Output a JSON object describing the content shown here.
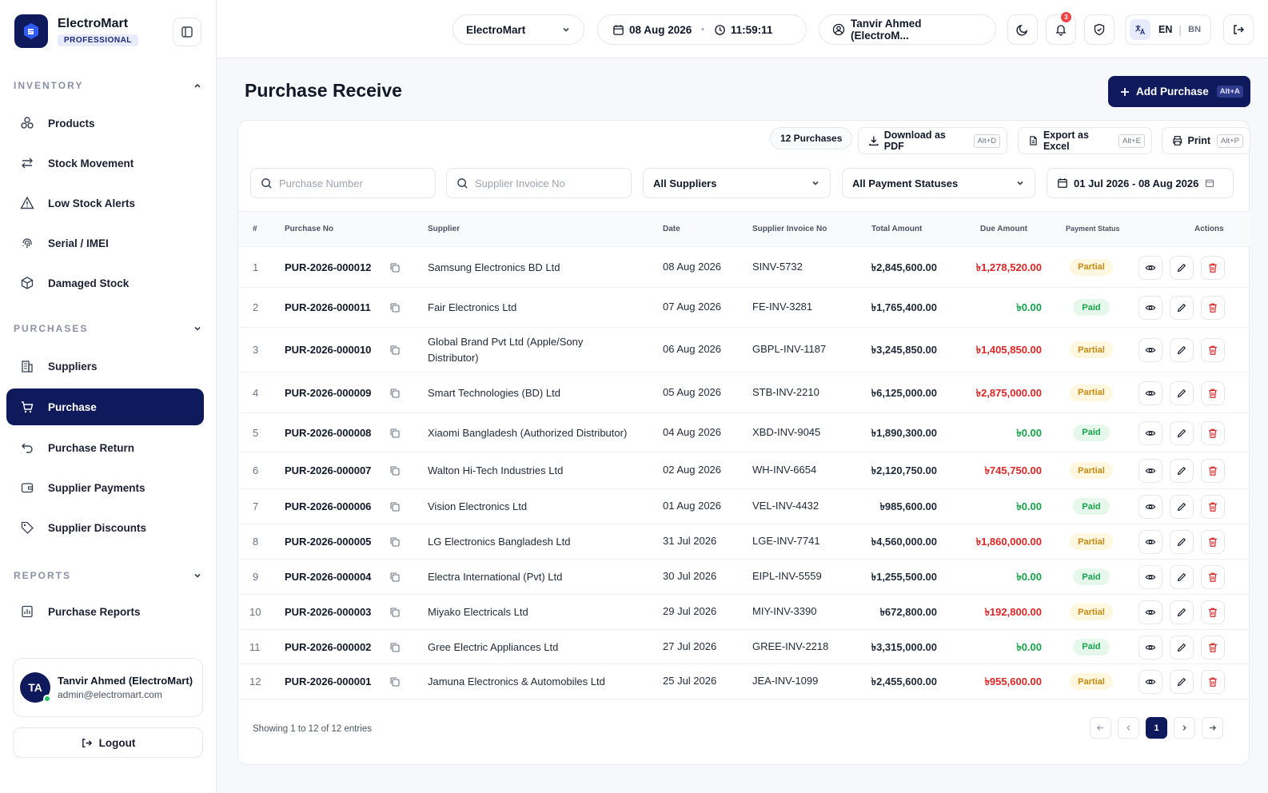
{
  "brand": {
    "name": "ElectroMart",
    "tier": "PROFESSIONAL"
  },
  "sidebar": {
    "sections": [
      {
        "title": "INVENTORY",
        "items": [
          {
            "label": "Products",
            "icon": "boxes-icon"
          },
          {
            "label": "Stock Movement",
            "icon": "arrows-exchange-icon"
          },
          {
            "label": "Low Stock Alerts",
            "icon": "warning-triangle-icon"
          },
          {
            "label": "Serial / IMEI",
            "icon": "fingerprint-icon"
          },
          {
            "label": "Damaged Stock",
            "icon": "damaged-box-icon"
          }
        ]
      },
      {
        "title": "PURCHASES",
        "items": [
          {
            "label": "Suppliers",
            "icon": "building-icon"
          },
          {
            "label": "Purchase",
            "icon": "cart-icon",
            "active": true
          },
          {
            "label": "Purchase Return",
            "icon": "return-arrow-icon"
          },
          {
            "label": "Supplier Payments",
            "icon": "wallet-icon"
          },
          {
            "label": "Supplier Discounts",
            "icon": "tag-icon"
          }
        ]
      },
      {
        "title": "REPORTS",
        "items": [
          {
            "label": "Purchase Reports",
            "icon": "report-icon"
          }
        ]
      }
    ],
    "user": {
      "initials": "TA",
      "name": "Tanvir Ahmed (ElectroMart)",
      "email": "admin@electromart.com"
    },
    "logout_label": "Logout"
  },
  "topbar": {
    "store": "ElectroMart",
    "date": "08 Aug 2026",
    "time": "11:59:11",
    "user": "Tanvir Ahmed (ElectroM...",
    "notif_count": "3",
    "lang_en": "EN",
    "lang_bn": "BN"
  },
  "page": {
    "title": "Purchase Receive",
    "add_label": "Add Purchase",
    "add_shortcut": "Alt+A",
    "count_label": "12 Purchases",
    "pdf_label": "Download as PDF",
    "pdf_shortcut": "Alt+D",
    "excel_label": "Export as Excel",
    "excel_shortcut": "Alt+E",
    "print_label": "Print",
    "print_shortcut": "Alt+P"
  },
  "filters": {
    "purchase_no_placeholder": "Purchase Number",
    "invoice_placeholder": "Supplier Invoice No",
    "supplier": "All Suppliers",
    "payment_status": "All Payment Statuses",
    "date_range": "01 Jul 2026 - 08 Aug 2026"
  },
  "table": {
    "headers": [
      "#",
      "Purchase No",
      "Supplier",
      "Date",
      "Supplier Invoice No",
      "Total Amount",
      "Due Amount",
      "Payment Status",
      "Actions"
    ],
    "rows": [
      {
        "idx": "1",
        "pno": "PUR-2026-000012",
        "supplier": "Samsung Electronics BD Ltd",
        "date": "08 Aug 2026",
        "inv": "SINV-5732",
        "total": "৳2,845,600.00",
        "due": "৳1,278,520.00",
        "status": "Partial"
      },
      {
        "idx": "2",
        "pno": "PUR-2026-000011",
        "supplier": "Fair Electronics Ltd",
        "date": "07 Aug 2026",
        "inv": "FE-INV-3281",
        "total": "৳1,765,400.00",
        "due": "৳0.00",
        "status": "Paid"
      },
      {
        "idx": "3",
        "pno": "PUR-2026-000010",
        "supplier": "Global Brand Pvt Ltd (Apple/Sony Distributor)",
        "date": "06 Aug 2026",
        "inv": "GBPL-INV-1187",
        "total": "৳3,245,850.00",
        "due": "৳1,405,850.00",
        "status": "Partial"
      },
      {
        "idx": "4",
        "pno": "PUR-2026-000009",
        "supplier": "Smart Technologies (BD) Ltd",
        "date": "05 Aug 2026",
        "inv": "STB-INV-2210",
        "total": "৳6,125,000.00",
        "due": "৳2,875,000.00",
        "status": "Partial"
      },
      {
        "idx": "5",
        "pno": "PUR-2026-000008",
        "supplier": "Xiaomi Bangladesh (Authorized Distributor)",
        "date": "04 Aug 2026",
        "inv": "XBD-INV-9045",
        "total": "৳1,890,300.00",
        "due": "৳0.00",
        "status": "Paid"
      },
      {
        "idx": "6",
        "pno": "PUR-2026-000007",
        "supplier": "Walton Hi-Tech Industries Ltd",
        "date": "02 Aug 2026",
        "inv": "WH-INV-6654",
        "total": "৳2,120,750.00",
        "due": "৳745,750.00",
        "status": "Partial"
      },
      {
        "idx": "7",
        "pno": "PUR-2026-000006",
        "supplier": "Vision Electronics Ltd",
        "date": "01 Aug 2026",
        "inv": "VEL-INV-4432",
        "total": "৳985,600.00",
        "due": "৳0.00",
        "status": "Paid"
      },
      {
        "idx": "8",
        "pno": "PUR-2026-000005",
        "supplier": "LG Electronics Bangladesh Ltd",
        "date": "31 Jul 2026",
        "inv": "LGE-INV-7741",
        "total": "৳4,560,000.00",
        "due": "৳1,860,000.00",
        "status": "Partial"
      },
      {
        "idx": "9",
        "pno": "PUR-2026-000004",
        "supplier": "Electra International (Pvt) Ltd",
        "date": "30 Jul 2026",
        "inv": "EIPL-INV-5559",
        "total": "৳1,255,500.00",
        "due": "৳0.00",
        "status": "Paid"
      },
      {
        "idx": "10",
        "pno": "PUR-2026-000003",
        "supplier": "Miyako Electricals Ltd",
        "date": "29 Jul 2026",
        "inv": "MIY-INV-3390",
        "total": "৳672,800.00",
        "due": "৳192,800.00",
        "status": "Partial"
      },
      {
        "idx": "11",
        "pno": "PUR-2026-000002",
        "supplier": "Gree Electric Appliances Ltd",
        "date": "27 Jul 2026",
        "inv": "GREE-INV-2218",
        "total": "৳3,315,000.00",
        "due": "৳0.00",
        "status": "Paid"
      },
      {
        "idx": "12",
        "pno": "PUR-2026-000001",
        "supplier": "Jamuna Electronics & Automobiles Ltd",
        "date": "25 Jul 2026",
        "inv": "JEA-INV-1099",
        "total": "৳2,455,600.00",
        "due": "৳955,600.00",
        "status": "Partial"
      }
    ]
  },
  "pagination": {
    "showing": "Showing 1 to 12 of 12 entries",
    "current": "1"
  }
}
